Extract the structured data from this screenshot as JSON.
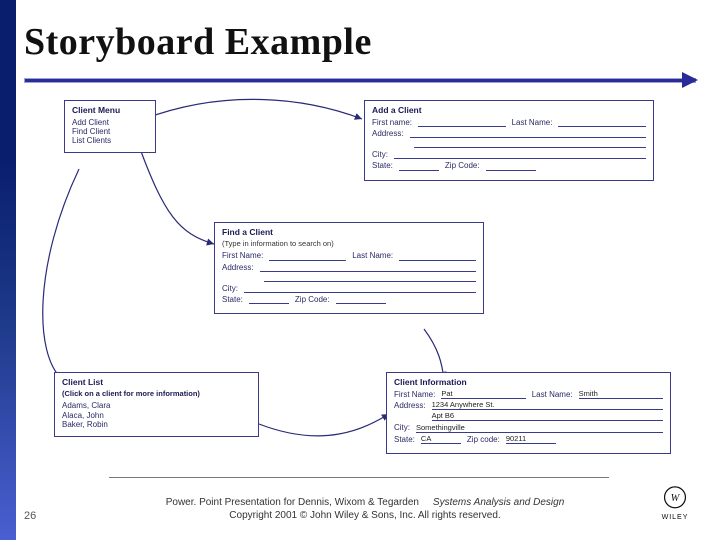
{
  "title": "Storyboard Example",
  "frames": {
    "menu": {
      "header": "Client Menu",
      "items": [
        "Add Client",
        "Find Client",
        "List Clients"
      ]
    },
    "add": {
      "header": "Add a Client",
      "first_name_label": "First name:",
      "last_name_label": "Last Name:",
      "address_label": "Address:",
      "city_label": "City:",
      "state_label": "State:",
      "zip_label": "Zip Code:"
    },
    "find": {
      "header": "Find a Client",
      "hint": "(Type in information to search on)",
      "first_name_label": "First Name:",
      "last_name_label": "Last Name:",
      "address_label": "Address:",
      "city_label": "City:",
      "state_label": "State:",
      "zip_label": "Zip Code:"
    },
    "list": {
      "header": "Client List",
      "hint": "(Click on a client for more information)",
      "items": [
        "Adams, Clara",
        "Alaca, John",
        "Baker, Robin"
      ]
    },
    "info": {
      "header": "Client Information",
      "first_name_label": "First Name:",
      "last_name_label": "Last Name:",
      "address_label": "Address:",
      "city_label": "City:",
      "state_label": "State:",
      "zip_label": "Zip code:",
      "values": {
        "first_name": "Pat",
        "last_name": "Smith",
        "address1": "1234 Anywhere St.",
        "address2": "Apt B6",
        "city": "Somethingville",
        "state": "CA",
        "zip": "90211"
      }
    }
  },
  "footer": {
    "page": "26",
    "line1_left": "Power. Point Presentation for Dennis, Wixom & Tegarden",
    "line1_right": "Systems Analysis and Design",
    "line2": "Copyright 2001 © John Wiley & Sons, Inc. All rights reserved.",
    "publisher": "WILEY"
  }
}
